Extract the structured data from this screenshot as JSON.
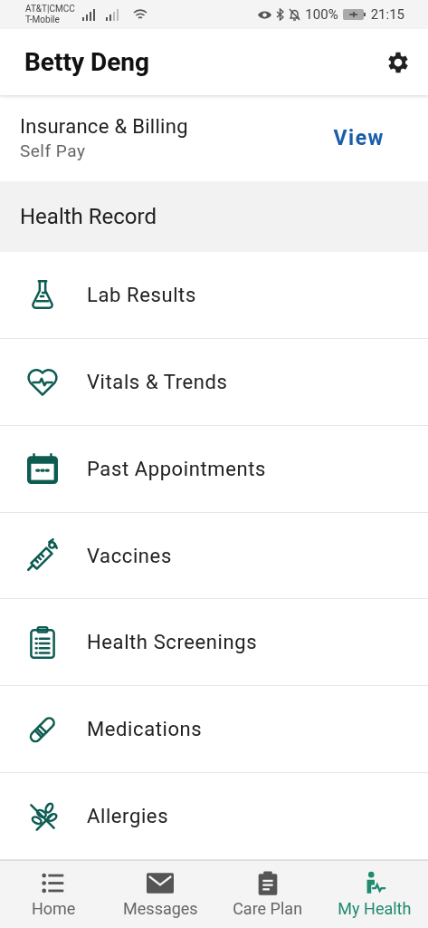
{
  "status_bar": {
    "carrier_1": "AT&T|CMCC",
    "carrier_2": "T-Mobile",
    "battery": "100%",
    "time": "21:15"
  },
  "header": {
    "title": "Betty Deng"
  },
  "insurance": {
    "title": "Insurance & Billing",
    "subtitle": "Self Pay",
    "action": "View"
  },
  "section": {
    "title": "Health Record"
  },
  "items": [
    {
      "kind": "flask",
      "label": "Lab Results"
    },
    {
      "kind": "heart",
      "label": "Vitals & Trends"
    },
    {
      "kind": "calendar",
      "label": "Past Appointments"
    },
    {
      "kind": "syringe",
      "label": "Vaccines"
    },
    {
      "kind": "clipboard",
      "label": "Health Screenings"
    },
    {
      "kind": "pill",
      "label": "Medications"
    },
    {
      "kind": "allergy",
      "label": "Allergies"
    }
  ],
  "tabs": [
    {
      "kind": "home",
      "label": "Home",
      "selected": false
    },
    {
      "kind": "messages",
      "label": "Messages",
      "selected": false
    },
    {
      "kind": "careplan",
      "label": "Care Plan",
      "selected": false
    },
    {
      "kind": "myhealth",
      "label": "My Health",
      "selected": true
    }
  ]
}
